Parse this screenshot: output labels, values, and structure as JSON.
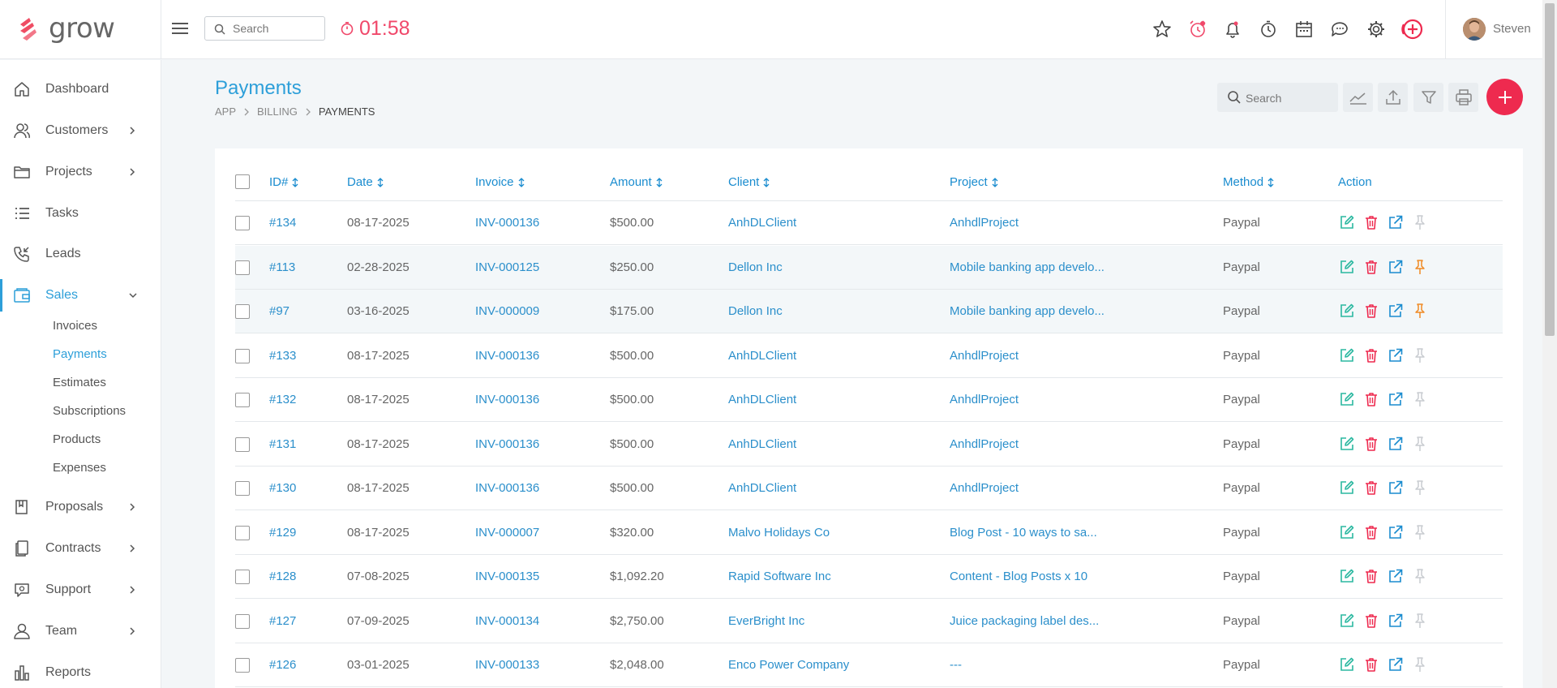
{
  "app": {
    "brand": "grow",
    "brand_color": "#ef4d64",
    "accent": "#2d9fd9",
    "danger": "#ee2a4f",
    "success": "#2bb8a0"
  },
  "topbar": {
    "search_placeholder": "Search",
    "timer": "01:58",
    "icons": [
      "star-icon",
      "alarm-icon",
      "bell-icon",
      "stopwatch-icon",
      "calendar-icon",
      "chat-icon",
      "gear-icon",
      "add-circle-icon"
    ],
    "user_name": "Steven"
  },
  "sidebar": {
    "items": [
      {
        "label": "Dashboard",
        "icon": "home-icon"
      },
      {
        "label": "Customers",
        "icon": "users-icon"
      },
      {
        "label": "Projects",
        "icon": "folder-icon"
      },
      {
        "label": "Tasks",
        "icon": "list-icon"
      },
      {
        "label": "Leads",
        "icon": "phone-icon"
      },
      {
        "label": "Sales",
        "icon": "wallet-icon"
      },
      {
        "label": "Proposals",
        "icon": "book-icon"
      },
      {
        "label": "Contracts",
        "icon": "documents-icon"
      },
      {
        "label": "Support",
        "icon": "support-icon"
      },
      {
        "label": "Team",
        "icon": "user-icon"
      },
      {
        "label": "Reports",
        "icon": "bar-chart-icon"
      }
    ],
    "sales_subitems": [
      "Invoices",
      "Payments",
      "Estimates",
      "Subscriptions",
      "Products",
      "Expenses"
    ]
  },
  "page": {
    "title": "Payments",
    "breadcrumb": [
      "APP",
      "BILLING",
      "PAYMENTS"
    ],
    "search_placeholder": "Search"
  },
  "table": {
    "columns": [
      "ID#",
      "Date",
      "Invoice",
      "Amount",
      "Client",
      "Project",
      "Method",
      "Action"
    ],
    "rows": [
      {
        "id": "#134",
        "date": "08-17-2025",
        "invoice": "INV-000136",
        "amount": "$500.00",
        "client": "AnhDLClient",
        "project": "AnhdlProject",
        "method": "Paypal",
        "pinned": false
      },
      {
        "id": "#113",
        "date": "02-28-2025",
        "invoice": "INV-000125",
        "amount": "$250.00",
        "client": "Dellon Inc",
        "project": "Mobile banking app develo...",
        "method": "Paypal",
        "pinned": true
      },
      {
        "id": "#97",
        "date": "03-16-2025",
        "invoice": "INV-000009",
        "amount": "$175.00",
        "client": "Dellon Inc",
        "project": "Mobile banking app develo...",
        "method": "Paypal",
        "pinned": true
      },
      {
        "id": "#133",
        "date": "08-17-2025",
        "invoice": "INV-000136",
        "amount": "$500.00",
        "client": "AnhDLClient",
        "project": "AnhdlProject",
        "method": "Paypal",
        "pinned": false
      },
      {
        "id": "#132",
        "date": "08-17-2025",
        "invoice": "INV-000136",
        "amount": "$500.00",
        "client": "AnhDLClient",
        "project": "AnhdlProject",
        "method": "Paypal",
        "pinned": false
      },
      {
        "id": "#131",
        "date": "08-17-2025",
        "invoice": "INV-000136",
        "amount": "$500.00",
        "client": "AnhDLClient",
        "project": "AnhdlProject",
        "method": "Paypal",
        "pinned": false
      },
      {
        "id": "#130",
        "date": "08-17-2025",
        "invoice": "INV-000136",
        "amount": "$500.00",
        "client": "AnhDLClient",
        "project": "AnhdlProject",
        "method": "Paypal",
        "pinned": false
      },
      {
        "id": "#129",
        "date": "08-17-2025",
        "invoice": "INV-000007",
        "amount": "$320.00",
        "client": "Malvo Holidays Co",
        "project": "Blog Post - 10 ways to sa...",
        "method": "Paypal",
        "pinned": false
      },
      {
        "id": "#128",
        "date": "07-08-2025",
        "invoice": "INV-000135",
        "amount": "$1,092.20",
        "client": "Rapid Software Inc",
        "project": "Content - Blog Posts x 10",
        "method": "Paypal",
        "pinned": false
      },
      {
        "id": "#127",
        "date": "07-09-2025",
        "invoice": "INV-000134",
        "amount": "$2,750.00",
        "client": "EverBright Inc",
        "project": "Juice packaging label des...",
        "method": "Paypal",
        "pinned": false
      },
      {
        "id": "#126",
        "date": "03-01-2025",
        "invoice": "INV-000133",
        "amount": "$2,048.00",
        "client": "Enco Power Company",
        "project": "---",
        "method": "Paypal",
        "pinned": false
      }
    ]
  }
}
